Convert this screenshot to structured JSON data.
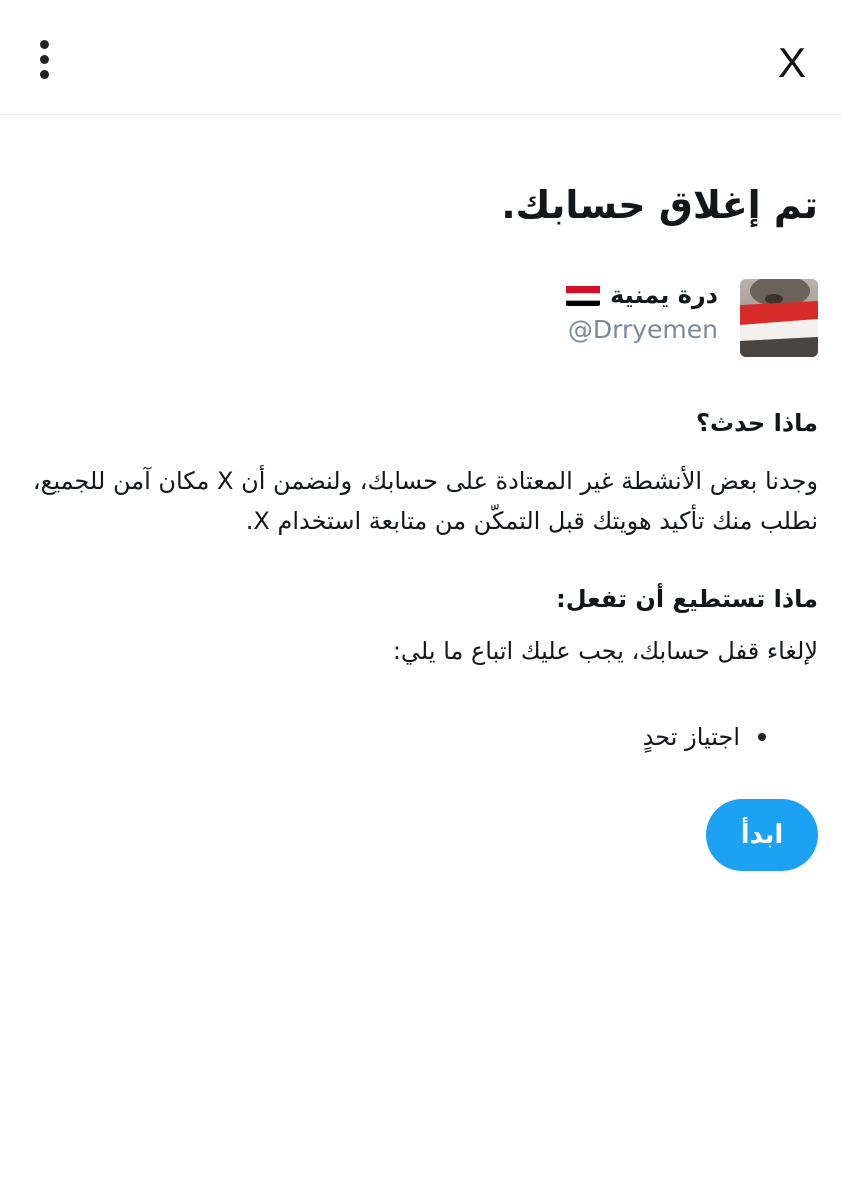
{
  "header": {
    "logo_text": "X",
    "menu_icon": "kebab-menu-icon"
  },
  "main": {
    "title": "تم إغلاق حسابك.",
    "account": {
      "display_name": "درة يمنية",
      "flag_icon": "yemen-flag-icon",
      "handle": "@Drryemen"
    },
    "what_happened": {
      "heading": "ماذا حدث؟",
      "body": "وجدنا بعض الأنشطة غير المعتادة على حسابك، ولنضمن أن X مكان آمن للجميع، نطلب منك تأكيد هويتك قبل التمكّن من متابعة استخدام X."
    },
    "what_you_can_do": {
      "heading": "ماذا تستطيع أن تفعل:",
      "body": "لإلغاء قفل حسابك، يجب عليك اتباع ما يلي:",
      "steps": [
        "اجتياز تحدٍ"
      ]
    },
    "start_button": "ابدأ"
  },
  "colors": {
    "accent": "#1da1f2",
    "handle": "#7b8a96",
    "text": "#14171a"
  }
}
